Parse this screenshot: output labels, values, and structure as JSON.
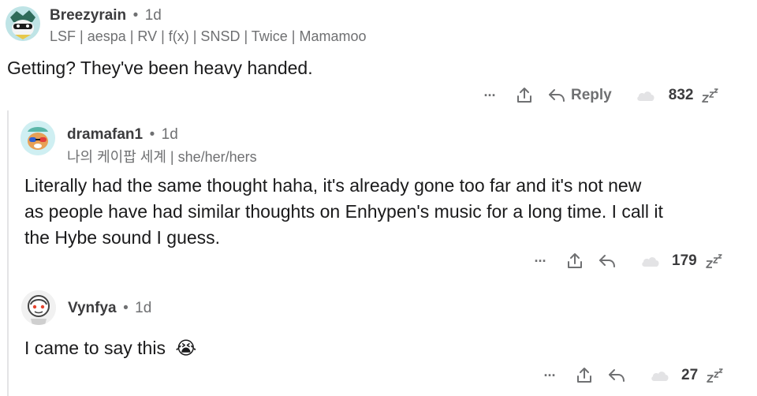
{
  "comments": [
    {
      "username": "Breezyrain",
      "separator": "•",
      "time": "1d",
      "flair": "LSF | aespa | RV | f(x) | SNSD | Twice | Mamamoo",
      "body": "Getting? They've been heavy handed.",
      "more": "···",
      "reply_label": "Reply",
      "score": "832"
    },
    {
      "username": "dramafan1",
      "separator": "•",
      "time": "1d",
      "flair": "나의 케이팝 세계 | she/her/hers",
      "body_lines": [
        "Literally had the same thought haha, it's already gone too far and it's not new",
        "as people have had similar thoughts on Enhypen's music for a long time. I call it",
        "the Hybe sound I guess."
      ],
      "more": "···",
      "score": "179"
    },
    {
      "username": "Vynfya",
      "separator": "•",
      "time": "1d",
      "body": "I came to say this",
      "emoji": "😭",
      "more": "···",
      "score": "27"
    }
  ],
  "icons": {
    "share": "share-icon",
    "reply": "reply-arrow-icon",
    "upvote": "cloud-upvote-icon",
    "downvote": "zzz-downvote-icon",
    "more": "more-options-icon"
  },
  "colors": {
    "text": "#1a1a1b",
    "muted": "#6f7072",
    "thread_line": "#e4e4e6"
  }
}
